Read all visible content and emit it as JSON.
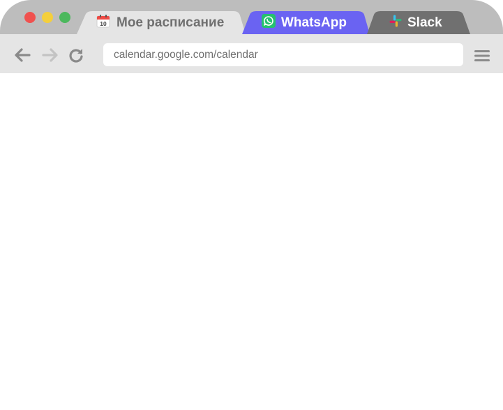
{
  "window": {
    "controls": [
      {
        "name": "close",
        "color": "#f0514f"
      },
      {
        "name": "minimize",
        "color": "#f4cf3c"
      },
      {
        "name": "maximize",
        "color": "#4cb85d"
      }
    ]
  },
  "tabs": [
    {
      "label": "Мое расписание",
      "icon": "calendar-icon",
      "active": true,
      "background": "#e5e5e5",
      "text_color": "#707070",
      "calendar_day": "10"
    },
    {
      "label": "WhatsApp",
      "icon": "whatsapp-icon",
      "active": false,
      "background": "#6a63f2",
      "text_color": "#ffffff"
    },
    {
      "label": "Slack",
      "icon": "slack-icon",
      "active": false,
      "background": "#707070",
      "text_color": "#ffffff"
    }
  ],
  "toolbar": {
    "back_icon": "arrow-left-icon",
    "forward_icon": "arrow-right-icon",
    "reload_icon": "reload-icon",
    "url": "calendar.google.com/calendar",
    "menu_icon": "hamburger-menu-icon"
  },
  "colors": {
    "titlebar": "#bdbdbd",
    "toolbar": "#e5e5e5",
    "content": "#ffffff"
  }
}
